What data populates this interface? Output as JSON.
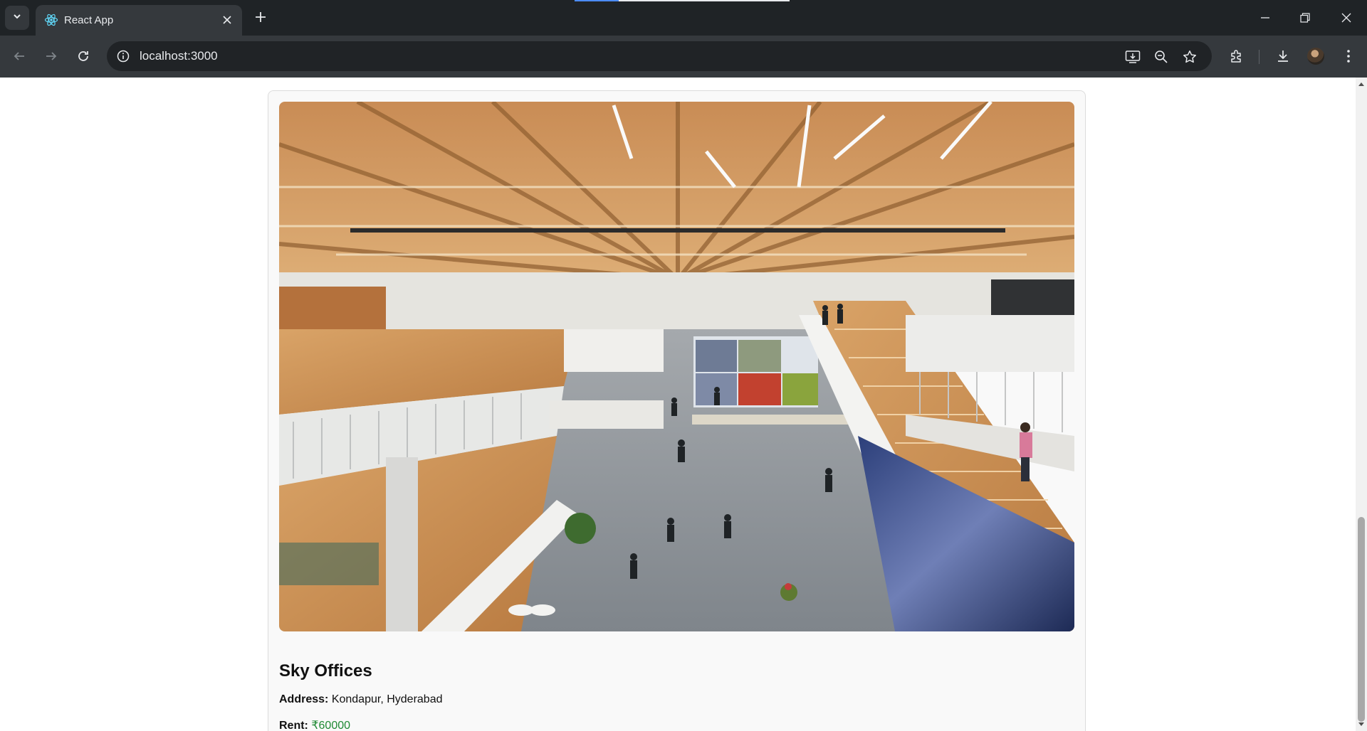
{
  "browser": {
    "tab": {
      "title": "React App"
    },
    "address_bar": {
      "url": "localhost:3000"
    },
    "icons": {
      "tab_search": "chevron-down-icon",
      "favicon": "react-logo-icon",
      "close_tab": "close-icon",
      "new_tab": "plus-icon",
      "minimize": "minimize-icon",
      "restore": "restore-icon",
      "close_window": "close-icon",
      "back": "back-arrow-icon",
      "forward": "forward-arrow-icon",
      "reload": "reload-icon",
      "site_info": "info-icon",
      "install_app": "install-app-icon",
      "zoom": "zoom-out-icon",
      "bookmark": "star-icon",
      "extensions": "puzzle-icon",
      "downloads": "download-icon",
      "profile": "avatar",
      "menu": "kebab-menu-icon"
    }
  },
  "listing": {
    "image": "office-interior-photo",
    "name": "Sky Offices",
    "address_label": "Address:",
    "address": "Kondapur, Hyderabad",
    "rent_label": "Rent:",
    "rent": "₹60000"
  },
  "colors": {
    "titlebar": "#1f2326",
    "toolbar": "#35393d",
    "omnibox": "#202326",
    "card_bg": "#f9f9f9",
    "rent_value": "#1f8a34"
  }
}
